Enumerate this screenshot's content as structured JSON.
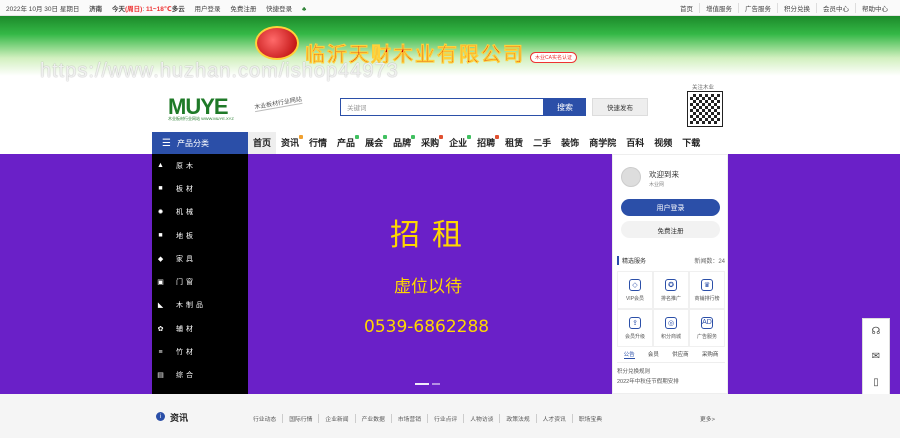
{
  "topbar": {
    "date": "2022年 10月 30日 星期日",
    "city": "济南",
    "weather_today": "今天",
    "weather_day": "(周日)",
    "weather_temp": "11~18℃",
    "weather_cond": "多云",
    "user_login": "用户登录",
    "free_register": "免费注册",
    "quick_login": "快捷登录",
    "right_links": [
      "首页",
      "增值服务",
      "广告服务",
      "积分兑换",
      "会员中心",
      "帮助中心"
    ]
  },
  "banner": {
    "company": "临沂天财木业有限公司",
    "tag": "木业CA实名认证"
  },
  "watermark": "https://www.huzhan.com/ishop44973",
  "header": {
    "logo_text": "MUYE",
    "logo_sub": "木业板材行业网站 WWW.MUYE.XYZ",
    "slogan": "木业板材行业网站",
    "search_placeholder": "关键词",
    "search_button": "搜索",
    "quick_publish": "快速发布",
    "qr_label": "关注木业"
  },
  "nav": {
    "category_title": "产品分类",
    "items": [
      {
        "label": "首页",
        "badge": ""
      },
      {
        "label": "资讯",
        "badge": "#f0a030"
      },
      {
        "label": "行情",
        "badge": ""
      },
      {
        "label": "产品",
        "badge": "#40c060"
      },
      {
        "label": "展会",
        "badge": "#40c060"
      },
      {
        "label": "品牌",
        "badge": "#40c060"
      },
      {
        "label": "采购",
        "badge": "#e05030"
      },
      {
        "label": "企业",
        "badge": "#40c060"
      },
      {
        "label": "招聘",
        "badge": "#e05030"
      },
      {
        "label": "租赁",
        "badge": ""
      },
      {
        "label": "二手",
        "badge": ""
      },
      {
        "label": "装饰",
        "badge": ""
      },
      {
        "label": "商学院",
        "badge": ""
      },
      {
        "label": "百科",
        "badge": ""
      },
      {
        "label": "视频",
        "badge": ""
      },
      {
        "label": "下载",
        "badge": ""
      }
    ]
  },
  "categories": [
    {
      "label": "原木",
      "icon": "▲"
    },
    {
      "label": "板材",
      "icon": "■"
    },
    {
      "label": "机械",
      "icon": "✹"
    },
    {
      "label": "地板",
      "icon": "■"
    },
    {
      "label": "家具",
      "icon": "◆"
    },
    {
      "label": "门窗",
      "icon": "▣"
    },
    {
      "label": "木制品",
      "icon": "◣"
    },
    {
      "label": "辅材",
      "icon": "✿"
    },
    {
      "label": "竹材",
      "icon": "≡"
    },
    {
      "label": "综合",
      "icon": "▤"
    }
  ],
  "hero": {
    "title": "招租",
    "subtitle": "虚位以待",
    "phone": "0539-6862288"
  },
  "side": {
    "welcome": "欢迎到来",
    "site": "木业网",
    "login_button": "用户登录",
    "register_button": "免费注册",
    "services_title": "精选服务",
    "services_count": "新闻数：24",
    "services": [
      {
        "label": "VIP会员",
        "icon": "◇"
      },
      {
        "label": "排名推广",
        "icon": "✪"
      },
      {
        "label": "商铺排行榜",
        "icon": "♛"
      },
      {
        "label": "会员升级",
        "icon": "⇪"
      },
      {
        "label": "积分商城",
        "icon": "◎"
      },
      {
        "label": "广告服务",
        "icon": "AD"
      }
    ],
    "tabs": [
      "公告",
      "会员",
      "供应商",
      "采购商"
    ],
    "notices": [
      "积分兑换规则",
      "2022年中秋佳节假期安排"
    ]
  },
  "float_icons": [
    "headset-icon",
    "chat-icon",
    "phone-icon"
  ],
  "news": {
    "title": "资讯",
    "links": [
      "行业动态",
      "国际行情",
      "企业新闻",
      "产业数据",
      "市场营销",
      "行业点评",
      "人物访谈",
      "政策法规",
      "人才资讯",
      "职场宝典"
    ],
    "more": "更多>"
  }
}
